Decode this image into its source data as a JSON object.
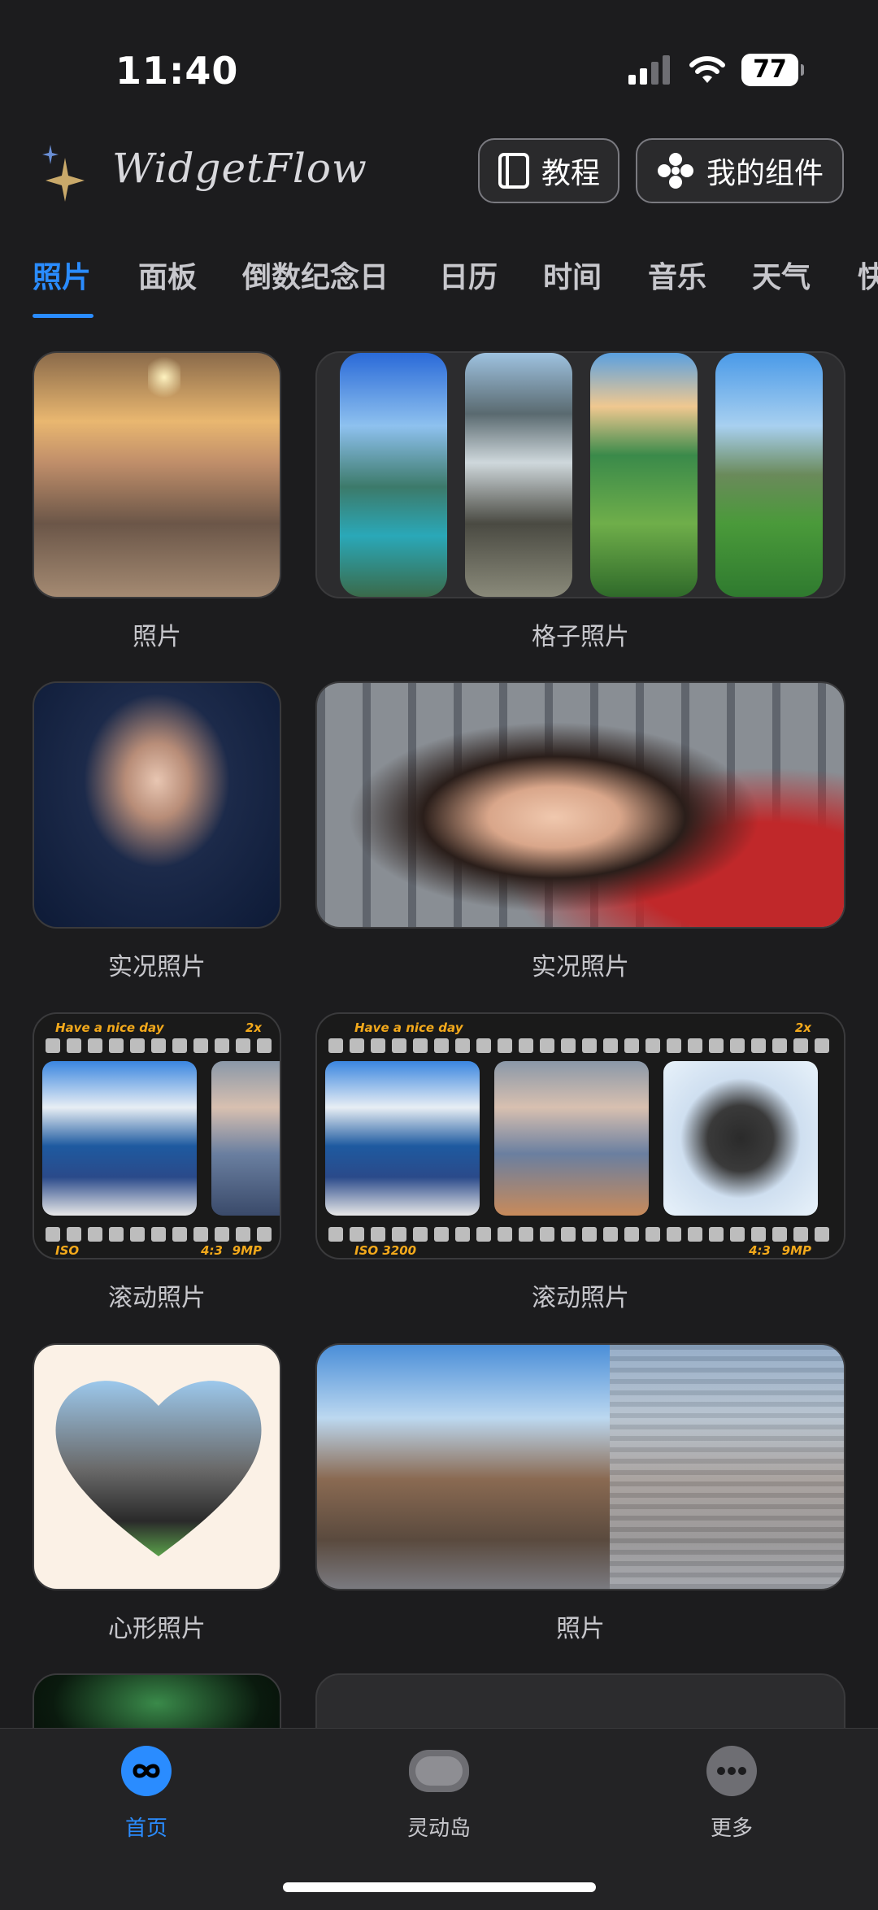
{
  "status": {
    "time": "11:40",
    "battery": "77"
  },
  "header": {
    "brand": "WidgetFlow",
    "tutorial_label": "教程",
    "my_widgets_label": "我的组件"
  },
  "tabs": [
    "照片",
    "面板",
    "倒数纪念日",
    "日历",
    "时间",
    "音乐",
    "天气",
    "快"
  ],
  "active_tab": "照片",
  "widgets": {
    "r1a": "照片",
    "r1b": "格子照片",
    "r2a": "实况照片",
    "r2b": "实况照片",
    "r3a": "滚动照片",
    "r3b": "滚动照片",
    "r4a": "心形照片",
    "r4b": "照片"
  },
  "film": {
    "top_text": "Have a nice day",
    "zoom": "2x",
    "iso_small": "ISO",
    "iso_large": "ISO 3200",
    "ratio": "4:3",
    "mp": "9MP"
  },
  "bottom_nav": {
    "home": "首页",
    "island": "灵动岛",
    "more": "更多"
  },
  "colors": {
    "accent": "#2a8cff",
    "background": "#1c1c1e",
    "film_text": "#f3a91b"
  },
  "icons": [
    "sparkle-icon",
    "book-icon",
    "widgets-icon",
    "infinity-icon",
    "pill-icon",
    "ellipsis-icon",
    "wifi-icon",
    "signal-icon"
  ]
}
